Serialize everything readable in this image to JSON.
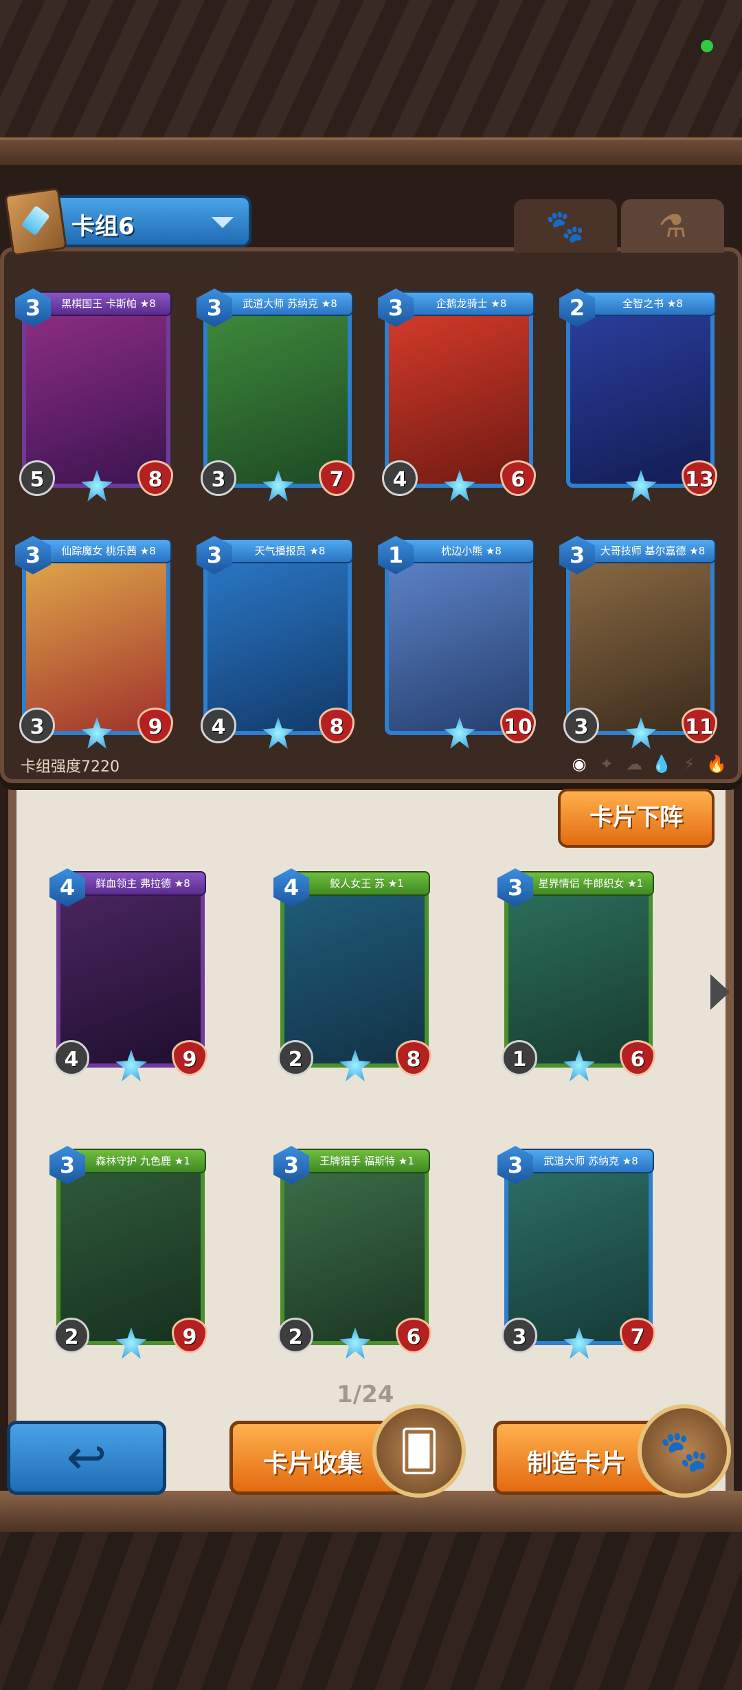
{
  "deck": {
    "title": "卡组6",
    "strength_label": "卡组强度7220",
    "tabs": [
      "🐾",
      "⚗"
    ]
  },
  "deck_cards": [
    {
      "name": "黑棋国王 卡斯帕 ★8",
      "cost": "3",
      "atk": "5",
      "hp": "8"
    },
    {
      "name": "武道大师 苏纳克 ★8",
      "cost": "3",
      "atk": "3",
      "hp": "7"
    },
    {
      "name": "企鹅龙骑士 ★8",
      "cost": "3",
      "atk": "4",
      "hp": "6"
    },
    {
      "name": "全智之书 ★8",
      "cost": "2",
      "atk": "",
      "hp": "13"
    },
    {
      "name": "仙踪魔女 桃乐茜 ★8",
      "cost": "3",
      "atk": "3",
      "hp": "9"
    },
    {
      "name": "天气播报员 ★8",
      "cost": "3",
      "atk": "4",
      "hp": "8"
    },
    {
      "name": "枕边小熊 ★8",
      "cost": "1",
      "atk": "",
      "hp": "10"
    },
    {
      "name": "大哥技师 基尔嘉德 ★8",
      "cost": "3",
      "atk": "3",
      "hp": "11"
    }
  ],
  "collection_cards": [
    {
      "name": "鲜血领主 弗拉德 ★8",
      "cost": "4",
      "atk": "4",
      "hp": "9",
      "color": "purple"
    },
    {
      "name": "鲛人女王 苏 ★1",
      "cost": "4",
      "atk": "2",
      "hp": "8",
      "color": "green"
    },
    {
      "name": "星界情侣 牛郎织女 ★1",
      "cost": "3",
      "atk": "1",
      "hp": "6",
      "color": "green"
    },
    {
      "name": "森林守护 九色鹿 ★1",
      "cost": "3",
      "atk": "2",
      "hp": "9",
      "color": "green"
    },
    {
      "name": "王牌猎手 福斯特 ★1",
      "cost": "3",
      "atk": "2",
      "hp": "6",
      "color": "green"
    },
    {
      "name": "武道大师 苏纳克 ★8",
      "cost": "3",
      "atk": "3",
      "hp": "7",
      "color": "blue"
    }
  ],
  "buttons": {
    "unequip": "卡片下阵",
    "collect": "卡片收集",
    "craft": "制造卡片",
    "back_icon": "↩"
  },
  "pagination": "1/24",
  "filters": [
    "◉",
    "✦",
    "☁",
    "💧",
    "⚡",
    "🔥"
  ],
  "icons": {
    "back": "back-arrow-icon",
    "collect": "card-collection-icon",
    "craft": "potion-jar-icon"
  }
}
